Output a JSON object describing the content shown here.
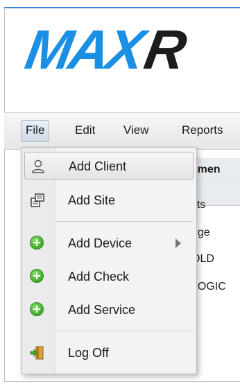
{
  "logo": {
    "blue_text": "MAX",
    "dark_text": "R"
  },
  "menubar": {
    "items": [
      {
        "label": "File"
      },
      {
        "label": "Edit"
      },
      {
        "label": "View"
      },
      {
        "label": "Reports"
      }
    ]
  },
  "background": {
    "grid_header": "gemen",
    "grid_col": "ents",
    "rows": [
      "uge",
      "OLD",
      "LOGIC"
    ]
  },
  "dropdown": {
    "items": [
      {
        "label": "Add Client",
        "icon": "user-icon"
      },
      {
        "label": "Add Site",
        "icon": "site-icon"
      },
      {
        "label": "Add Device",
        "icon": "add-icon",
        "has_submenu": true
      },
      {
        "label": "Add Check",
        "icon": "add-icon"
      },
      {
        "label": "Add Service",
        "icon": "add-icon"
      },
      {
        "label": "Log Off",
        "icon": "logoff-door-icon"
      }
    ]
  },
  "colors": {
    "brand_blue": "#1b8fe3",
    "add_green": "#3ea82a"
  }
}
